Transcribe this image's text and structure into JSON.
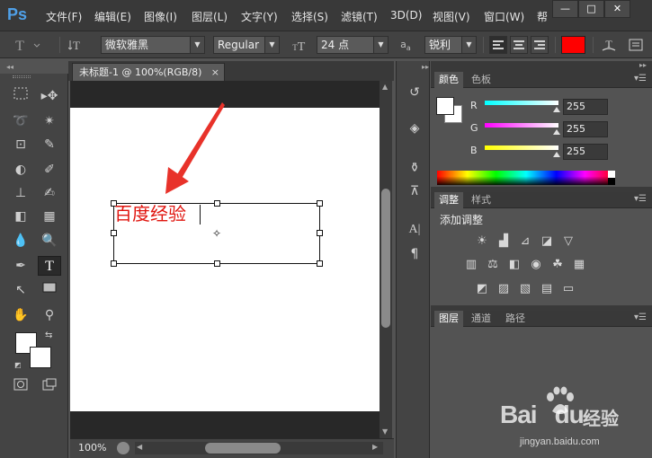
{
  "app": {
    "logo": "Ps",
    "menu": [
      "文件(F)",
      "编辑(E)",
      "图像(I)",
      "图层(L)",
      "文字(Y)",
      "选择(S)",
      "滤镜(T)",
      "3D(D)",
      "视图(V)",
      "窗口(W)",
      "帮"
    ],
    "window_buttons": [
      "—",
      "□",
      "✕"
    ]
  },
  "options": {
    "font_family": "微软雅黑",
    "font_style": "Regular",
    "font_size": "24 点",
    "antialias_label": "a",
    "antialias": "锐利",
    "text_color": "#ff0000"
  },
  "document": {
    "tab_title": "未标题-1 @ 100%(RGB/8)",
    "tab_close": "×",
    "text": "百度经验",
    "text_color": "#e0150f",
    "zoom": "100%"
  },
  "color_panel": {
    "tabs": [
      "颜色",
      "色板"
    ],
    "sliders": [
      {
        "label": "R",
        "value": "255",
        "gradient": "linear-gradient(to right, #00ffff, #ffffff)"
      },
      {
        "label": "G",
        "value": "255",
        "gradient": "linear-gradient(to right, #ff00ff, #ffffff)"
      },
      {
        "label": "B",
        "value": "255",
        "gradient": "linear-gradient(to right, #ffff00, #ffffff)"
      }
    ]
  },
  "adjust_panel": {
    "tabs": [
      "调整",
      "样式"
    ],
    "title": "添加调整"
  },
  "layers_panel": {
    "tabs": [
      "图层",
      "通道",
      "路径"
    ]
  },
  "watermark": {
    "brand": "Bai",
    "brand2": "du",
    "jingyan": "经验",
    "url": "jingyan.baidu.com"
  }
}
